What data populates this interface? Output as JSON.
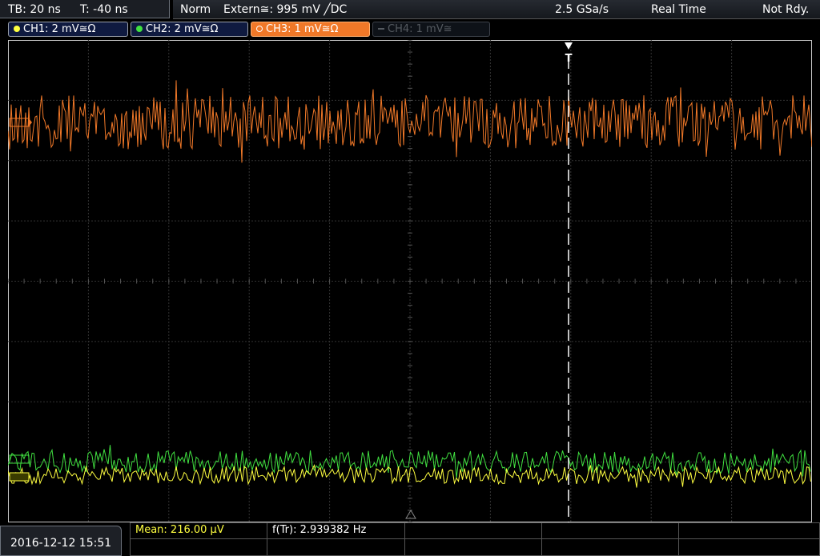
{
  "timebase": {
    "tb": "TB: 20 ns",
    "t": "T: -40 ns"
  },
  "status": {
    "mode": "Norm",
    "trigger": "Extern≅: 995 mV ╱DC",
    "sample_rate": "2.5 GSa/s",
    "acq": "Real Time",
    "state": "Not Rdy."
  },
  "channels": [
    {
      "label": "CH1: 2 mV≅Ω",
      "color": "#ffff40",
      "active": true
    },
    {
      "label": "CH2: 2 mV≅Ω",
      "color": "#40e040",
      "active": true
    },
    {
      "label": "CH3: 1 mV≅Ω",
      "color": "#f07828",
      "active": true,
      "selected": true
    },
    {
      "label": "CH4: 1 mV≅",
      "color": "#555a60",
      "active": false
    }
  ],
  "trigger_marker": "T",
  "footer": {
    "datetime": "2016-12-12 15:51",
    "mean": "Mean: 216.00 µV",
    "ftr": "f(Tr): 2.939382 Hz"
  },
  "colors": {
    "ch1": "#ffff40",
    "ch2": "#40e040",
    "ch3": "#f07828",
    "grid": "#3a3a3a",
    "border": "#c8c8c8"
  }
}
